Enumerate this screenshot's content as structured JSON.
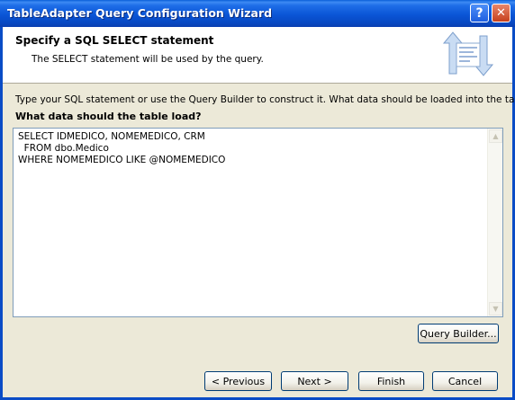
{
  "window": {
    "title": "TableAdapter Query Configuration Wizard",
    "help_glyph": "?",
    "close_glyph": "✕"
  },
  "header": {
    "title": "Specify a SQL SELECT statement",
    "subtitle": "The SELECT statement will be used by the query.",
    "icon": "database-transfer-icon"
  },
  "main": {
    "intro": "Type your SQL statement or use the Query Builder to construct it. What data should be loaded into the table?",
    "question_label": "What data should the table load?",
    "sql_text": "SELECT IDMEDICO, NOMEMEDICO, CRM\n  FROM dbo.Medico\nWHERE NOMEMEDICO LIKE @NOMEMEDICO",
    "query_builder_label": "Query Builder..."
  },
  "footer": {
    "previous_label": "< Previous",
    "next_label": "Next >",
    "finish_label": "Finish",
    "cancel_label": "Cancel"
  },
  "colors": {
    "titlebar": "#0a55d6",
    "dialog_bg": "#ece9d8",
    "button_border": "#003c74"
  }
}
